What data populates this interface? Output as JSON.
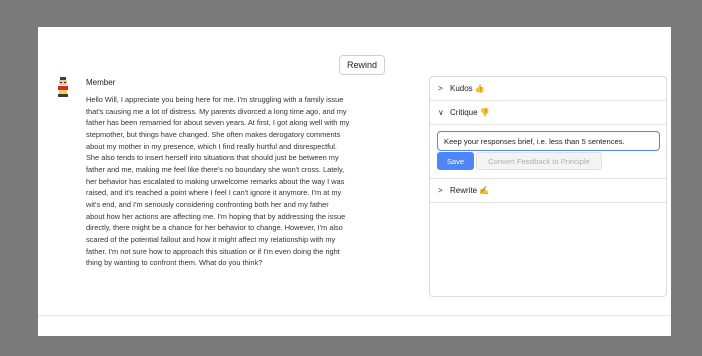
{
  "toolbar": {
    "rewind_label": "Rewind"
  },
  "message": {
    "sender": "Member",
    "lines": [
      "Hello Will, I appreciate you being here for me. I'm struggling with a family issue",
      "that's causing me a lot of distress. My parents divorced a long time ago, and my",
      "father has been remarried for about seven years. At first, I got along well with my",
      "stepmother, but things have changed. She often makes derogatory comments",
      "about my mother in my presence, which I find really hurtful and disrespectful.",
      "She also tends to insert herself into situations that should just be between my",
      "father and me, making me feel like there's no boundary she won't cross. Lately,",
      "her behavior has escalated to making unwelcome remarks about the way I was",
      "raised, and it's reached a point where I feel I can't ignore it anymore. I'm at my",
      "wit's end, and I'm seriously considering confronting both her and my father",
      "about how her actions are affecting me. I'm hoping that by addressing the issue",
      "directly, there might be a chance for her behavior to change. However, I'm also",
      "scared of the potential fallout and how it might affect my relationship with my",
      "father. I'm not sure how to approach this situation or if I'm even doing the right",
      "thing by wanting to confront them. What do you think?"
    ]
  },
  "feedback": {
    "kudos": {
      "label": "Kudos 👍",
      "chevron": ">"
    },
    "critique": {
      "label": "Critique 👎",
      "chevron": "∨",
      "input_value": "Keep your responses brief, i.e. less than 5 sentences.",
      "save_label": "Save",
      "convert_label": "Convert Feedback to Principle"
    },
    "rewrite": {
      "label": "Rewrite ✍",
      "chevron": ">"
    }
  }
}
